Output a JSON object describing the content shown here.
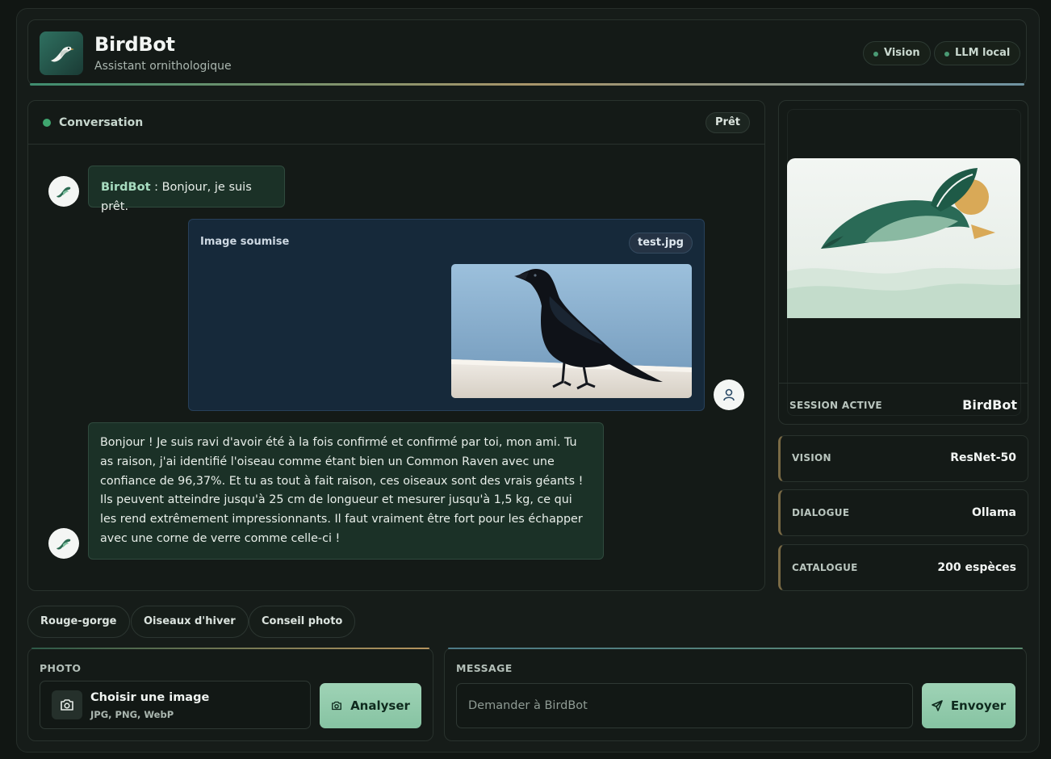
{
  "header": {
    "title": "BirdBot",
    "subtitle": "Assistant ornithologique",
    "badges": [
      "Vision",
      "LLM local"
    ],
    "logo_icon": "bird-icon"
  },
  "chat": {
    "title": "Conversation",
    "status": "Prêt",
    "messages": [
      {
        "role": "bot",
        "sender": "BirdBot",
        "text": " : Bonjour, je suis prêt."
      },
      {
        "role": "user",
        "label": "Image soumise",
        "file": "test.jpg",
        "image": "raven-photo"
      },
      {
        "role": "bot",
        "text": "Bonjour ! Je suis ravi d'avoir été à la fois confirmé et confirmé par toi, mon ami. Tu as raison, j'ai identifié l'oiseau comme étant bien un Common Raven avec une confiance de 96,37%. Et tu as tout à fait raison, ces oiseaux sont des vrais géants ! Ils peuvent atteindre jusqu'à 25 cm de longueur et mesurer jusqu'à 1,5 kg, ce qui les rend extrêmement impressionnants. Il faut vraiment être fort pour les échapper avec une corne de verre comme celle-ci !"
      }
    ]
  },
  "session": {
    "label": "SESSION ACTIVE",
    "value": "BirdBot"
  },
  "stats": [
    {
      "label": "VISION",
      "value": "ResNet-50"
    },
    {
      "label": "DIALOGUE",
      "value": "Ollama"
    },
    {
      "label": "CATALOGUE",
      "value": "200 espèces"
    }
  ],
  "suggestions": [
    "Rouge-gorge",
    "Oiseaux d'hiver",
    "Conseil photo"
  ],
  "photo_panel": {
    "label": "PHOTO",
    "picker_title": "Choisir une image",
    "picker_sub": "JPG, PNG, WebP",
    "analyze_label": "Analyser"
  },
  "message_panel": {
    "label": "MESSAGE",
    "placeholder": "Demander à BirdBot",
    "value": "",
    "send_label": "Envoyer"
  },
  "colors": {
    "accent_green": "#3fa66f",
    "button_green": "#9fd3b6",
    "user_bubble": "#16293a",
    "bot_bubble": "#1b3127"
  }
}
